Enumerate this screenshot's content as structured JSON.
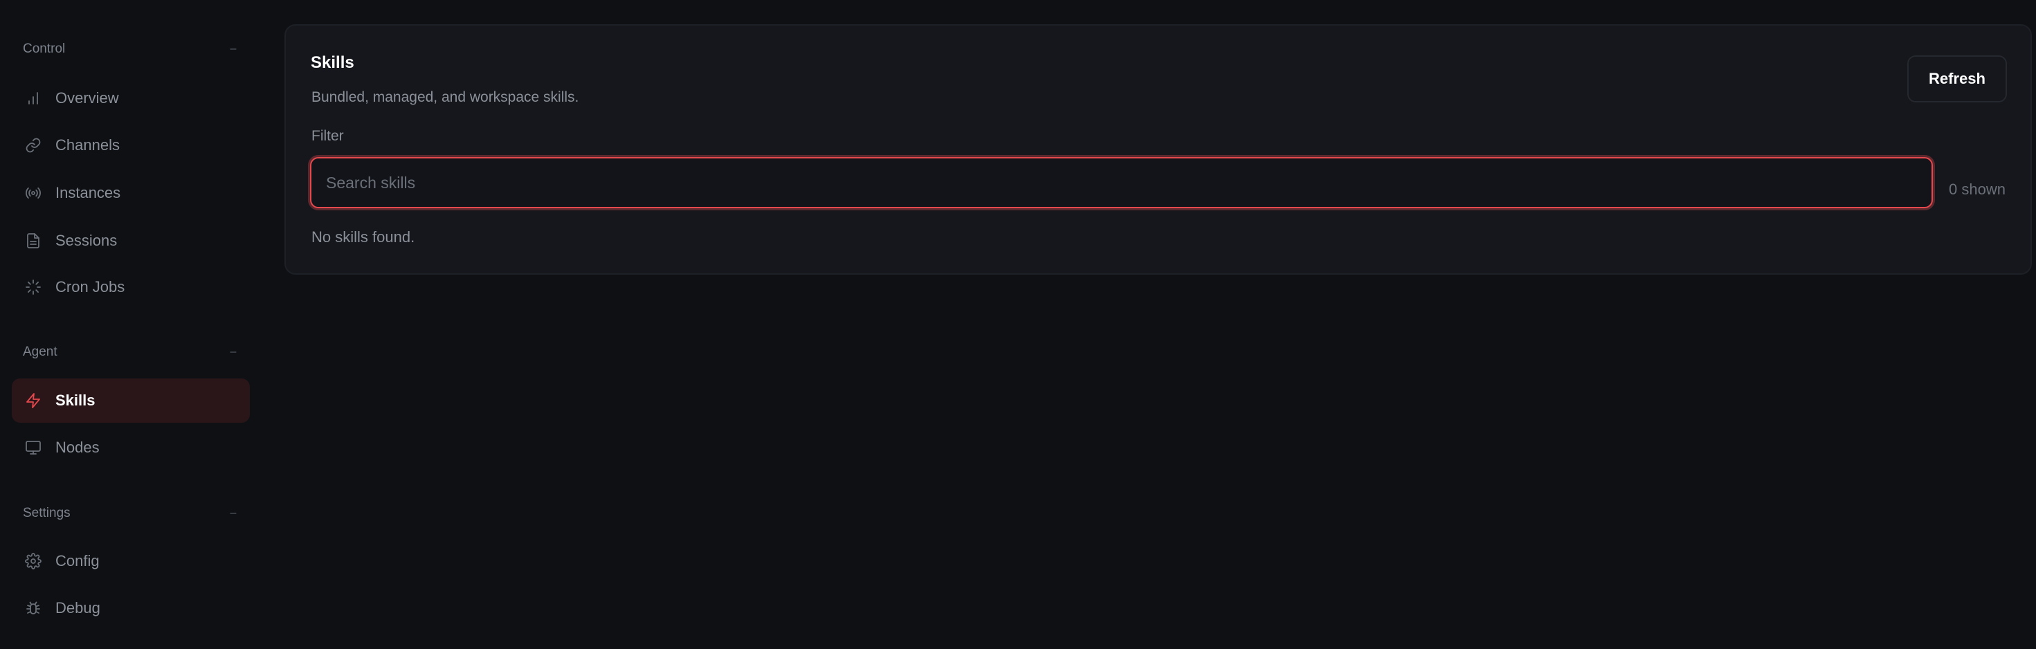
{
  "sidebar": {
    "groups": [
      {
        "title": "Control",
        "collapse_glyph": "–",
        "items": [
          {
            "label": "Overview",
            "icon": "bar-chart-icon"
          },
          {
            "label": "Channels",
            "icon": "link-icon"
          },
          {
            "label": "Instances",
            "icon": "broadcast-icon"
          },
          {
            "label": "Sessions",
            "icon": "document-icon"
          },
          {
            "label": "Cron Jobs",
            "icon": "loader-icon"
          }
        ]
      },
      {
        "title": "Agent",
        "collapse_glyph": "–",
        "items": [
          {
            "label": "Skills",
            "icon": "zap-icon",
            "active": true
          },
          {
            "label": "Nodes",
            "icon": "monitor-icon"
          }
        ]
      },
      {
        "title": "Settings",
        "collapse_glyph": "–",
        "items": [
          {
            "label": "Config",
            "icon": "gear-icon"
          },
          {
            "label": "Debug",
            "icon": "bug-icon"
          }
        ]
      }
    ]
  },
  "main": {
    "title": "Skills",
    "subtitle": "Bundled, managed, and workspace skills.",
    "refresh_label": "Refresh",
    "filter_label": "Filter",
    "search": {
      "placeholder": "Search skills",
      "value": ""
    },
    "shown_count": "0 shown",
    "empty_message": "No skills found."
  },
  "colors": {
    "accent": "#e5484d",
    "background": "#0e1014",
    "card": "#15171c",
    "active_bg": "#2a1619"
  }
}
